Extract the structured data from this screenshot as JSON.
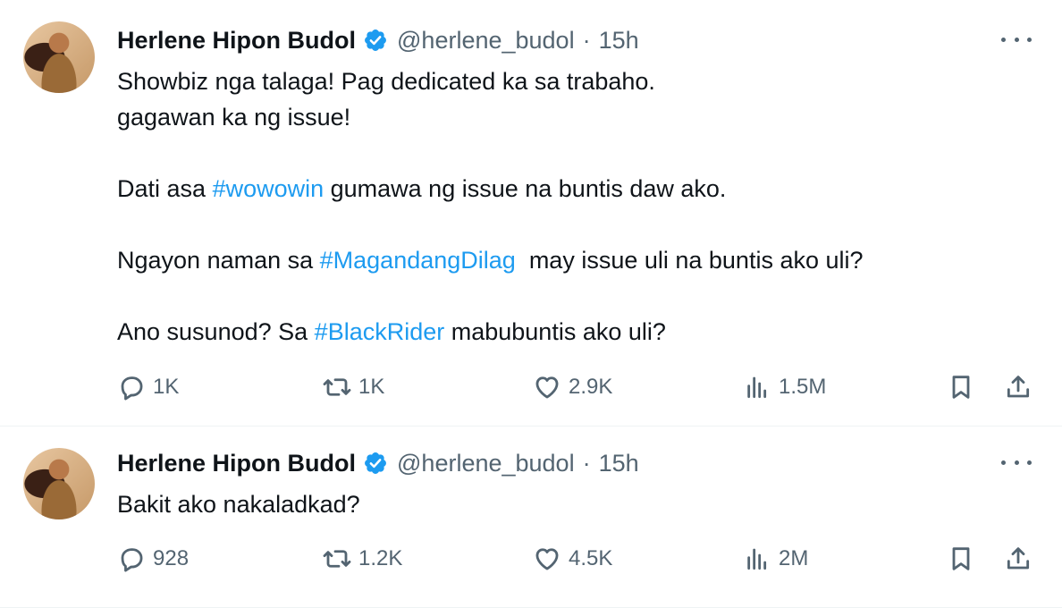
{
  "tweets": [
    {
      "author": {
        "name": "Herlene Hipon Budol",
        "handle": "@herlene_budol",
        "time": "15h"
      },
      "text": {
        "line1": "Showbiz nga talaga! Pag dedicated ka sa trabaho.",
        "line2": "gagawan ka ng issue!",
        "p2_pre": "Dati asa ",
        "p2_tag": "#wowowin",
        "p2_post": " gumawa ng issue na buntis daw ako.",
        "p3_pre": "Ngayon naman sa ",
        "p3_tag": "#MagandangDilag",
        "p3_post": "  may issue uli na buntis ako uli?",
        "p4_pre": "Ano susunod? Sa ",
        "p4_tag": "#BlackRider",
        "p4_post": " mabubuntis ako uli?"
      },
      "stats": {
        "replies": "1K",
        "reposts": "1K",
        "likes": "2.9K",
        "views": "1.5M"
      }
    },
    {
      "author": {
        "name": "Herlene Hipon Budol",
        "handle": "@herlene_budol",
        "time": "15h"
      },
      "text": {
        "line1": "Bakit ako nakaladkad?"
      },
      "stats": {
        "replies": "928",
        "reposts": "1.2K",
        "likes": "4.5K",
        "views": "2M"
      }
    }
  ],
  "ui": {
    "separator": "·",
    "icons": [
      "verified-badge-icon",
      "more-icon",
      "reply-icon",
      "repost-icon",
      "like-icon",
      "views-icon",
      "bookmark-icon",
      "share-icon"
    ],
    "colors": {
      "text": "#0f1419",
      "secondary": "#536471",
      "link": "#1d9bf0",
      "verified": "#1d9bf0",
      "divider": "#eff3f4"
    }
  }
}
